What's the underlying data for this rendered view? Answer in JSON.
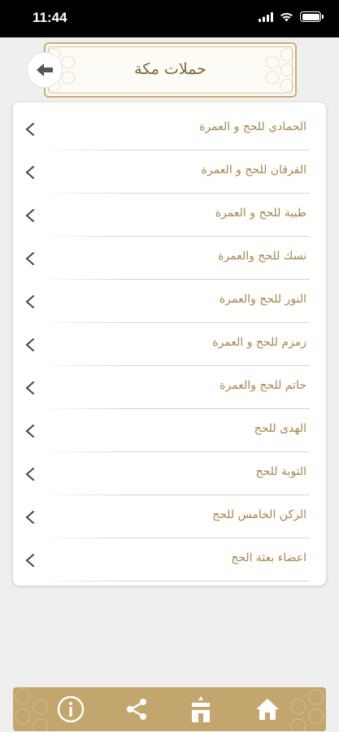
{
  "status_bar": {
    "time": "11:44"
  },
  "header": {
    "title": "حملات مكة"
  },
  "list": {
    "items": [
      {
        "label": "الحمادي للحج و العمرة"
      },
      {
        "label": "الفرقان للحج و العمرة"
      },
      {
        "label": "طيبة للحج و العمرة"
      },
      {
        "label": "نسك للحج والعمرة"
      },
      {
        "label": "النور للحج والعمرة"
      },
      {
        "label": "زمزم للحج و العمرة"
      },
      {
        "label": "حاتم للحج والعمرة"
      },
      {
        "label": "الهدى للحج"
      },
      {
        "label": "التوبة للحج"
      },
      {
        "label": "الركن الخامس للحج"
      },
      {
        "label": "اعضاء بعثة الحج"
      }
    ]
  },
  "tabbar": {
    "tabs": [
      {
        "icon": "info-icon"
      },
      {
        "icon": "share-icon"
      },
      {
        "icon": "kaaba-icon"
      },
      {
        "icon": "home-icon"
      }
    ]
  },
  "colors": {
    "accent_gold": "#c3a66e",
    "label_gold": "#a4884f",
    "title_brown": "#7e6637"
  }
}
